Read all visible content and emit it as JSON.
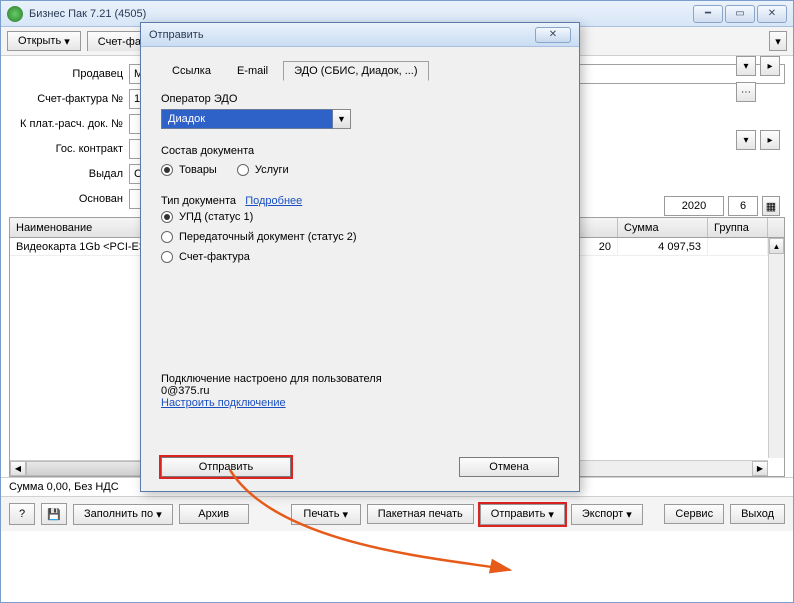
{
  "window": {
    "title": "Бизнес Пак 7.21 (4505)"
  },
  "toolbar": {
    "open_label": "Открыть",
    "tab1_label": "Счет-фак"
  },
  "form": {
    "seller_label": "Продавец",
    "seller_value": "МА",
    "invoice_no_label": "Счет-фактура №",
    "invoice_no_value": "1",
    "pay_doc_label": "К плат.-расч. док. №",
    "gov_contract_label": "Гос. контракт",
    "issued_label": "Выдал",
    "issued_value": "Се",
    "basis_label": "Основан",
    "year_value": "2020",
    "day_value": "6"
  },
  "grid": {
    "col_name": "Наименование",
    "col_qty": "",
    "col_sum": "Сумма",
    "col_group": "Группа",
    "rows": [
      {
        "name": "Видеокарта 1Gb <PCI-E>",
        "qty": "20",
        "sum": "4 097,53",
        "group": ""
      }
    ]
  },
  "status": "Сумма 0,00, Без НДС",
  "bottom": {
    "fill_by": "Заполнить по",
    "archive": "Архив",
    "print": "Печать",
    "batch_print": "Пакетная печать",
    "send": "Отправить",
    "export": "Экспорт",
    "service": "Сервис",
    "exit": "Выход"
  },
  "dialog": {
    "title": "Отправить",
    "tab_link": "Ссылка",
    "tab_email": "E-mail",
    "tab_edo": "ЭДО (СБИС, Диадок, ...)",
    "operator_label": "Оператор ЭДО",
    "operator_value": "Диадок",
    "composition_label": "Состав документа",
    "comp_goods": "Товары",
    "comp_services": "Услуги",
    "doctype_label": "Тип документа",
    "more_link": "Подробнее",
    "dt_upd": "УПД (статус 1)",
    "dt_transfer": "Передаточный документ (статус 2)",
    "dt_invoice": "Счет-фактура",
    "conn_line1": "Подключение настроено для пользователя",
    "conn_line2": "0@375.ru",
    "conn_link": "Настроить подключение",
    "send_btn": "Отправить",
    "cancel_btn": "Отмена"
  }
}
